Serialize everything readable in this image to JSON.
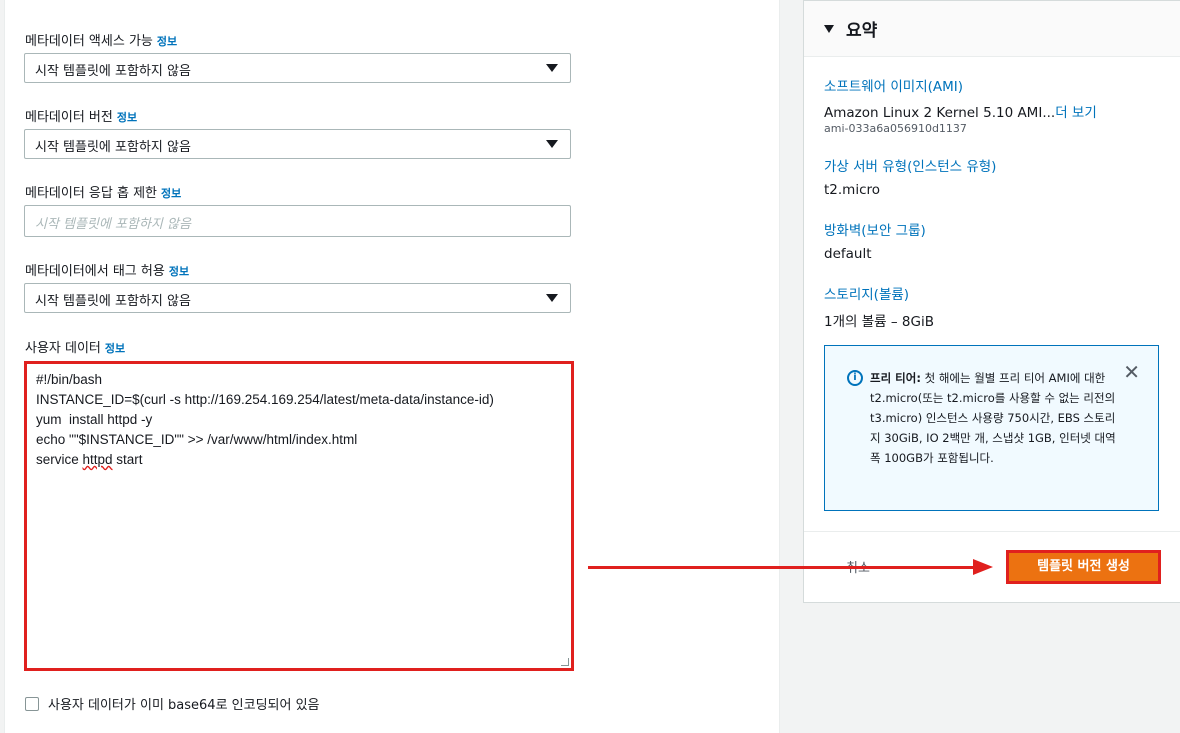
{
  "form": {
    "metadata_access": {
      "label": "메타데이터 액세스 가능",
      "info": "정보",
      "value": "시작 템플릿에 포함하지 않음"
    },
    "metadata_version": {
      "label": "메타데이터 버전",
      "info": "정보",
      "value": "시작 템플릿에 포함하지 않음"
    },
    "metadata_hop_limit": {
      "label": "메타데이터 응답 홉 제한",
      "info": "정보",
      "placeholder": "시작 템플릿에 포함하지 않음"
    },
    "metadata_tags": {
      "label": "메타데이터에서 태그 허용",
      "info": "정보",
      "value": "시작 템플릿에 포함하지 않음"
    },
    "user_data": {
      "label": "사용자 데이터",
      "info": "정보",
      "lines": [
        "#!/bin/bash",
        "INSTANCE_ID=$(curl -s http://169.254.169.254/latest/meta-data/instance-id)",
        "yum  install httpd -y",
        "echo \"\"$INSTANCE_ID\"\" >> /var/www/html/index.html",
        "service httpd start"
      ]
    },
    "base64_checkbox": "사용자 데이터가 이미 base64로 인코딩되어 있음"
  },
  "summary": {
    "title": "요약",
    "ami_label": "소프트웨어 이미지(AMI)",
    "ami_value": "Amazon Linux 2 Kernel 5.10 AMI...",
    "ami_more": "더 보기",
    "ami_id": "ami-033a6a056910d1137",
    "instance_type_label": "가상 서버 유형(인스턴스 유형)",
    "instance_type_value": "t2.micro",
    "firewall_label": "방화벽(보안 그룹)",
    "firewall_value": "default",
    "storage_label": "스토리지(볼륨)",
    "storage_value": "1개의 볼륨 – 8GiB",
    "free_tier_title": "프리 티어:",
    "free_tier_text": "첫 해에는 월별 프리 티어 AMI에 대한 t2.micro(또는 t2.micro를 사용할 수 없는 리전의 t3.micro) 인스턴스 사용량 750시간, EBS 스토리지 30GiB, IO 2백만 개, 스냅샷 1GB, 인터넷 대역폭 100GB가 포함됩니다.",
    "cancel_label": "취소",
    "create_label": "템플릿 버전 생성"
  },
  "colors": {
    "accent": "#0073bb",
    "primary_button": "#ec7211",
    "highlight": "#e0201e"
  }
}
